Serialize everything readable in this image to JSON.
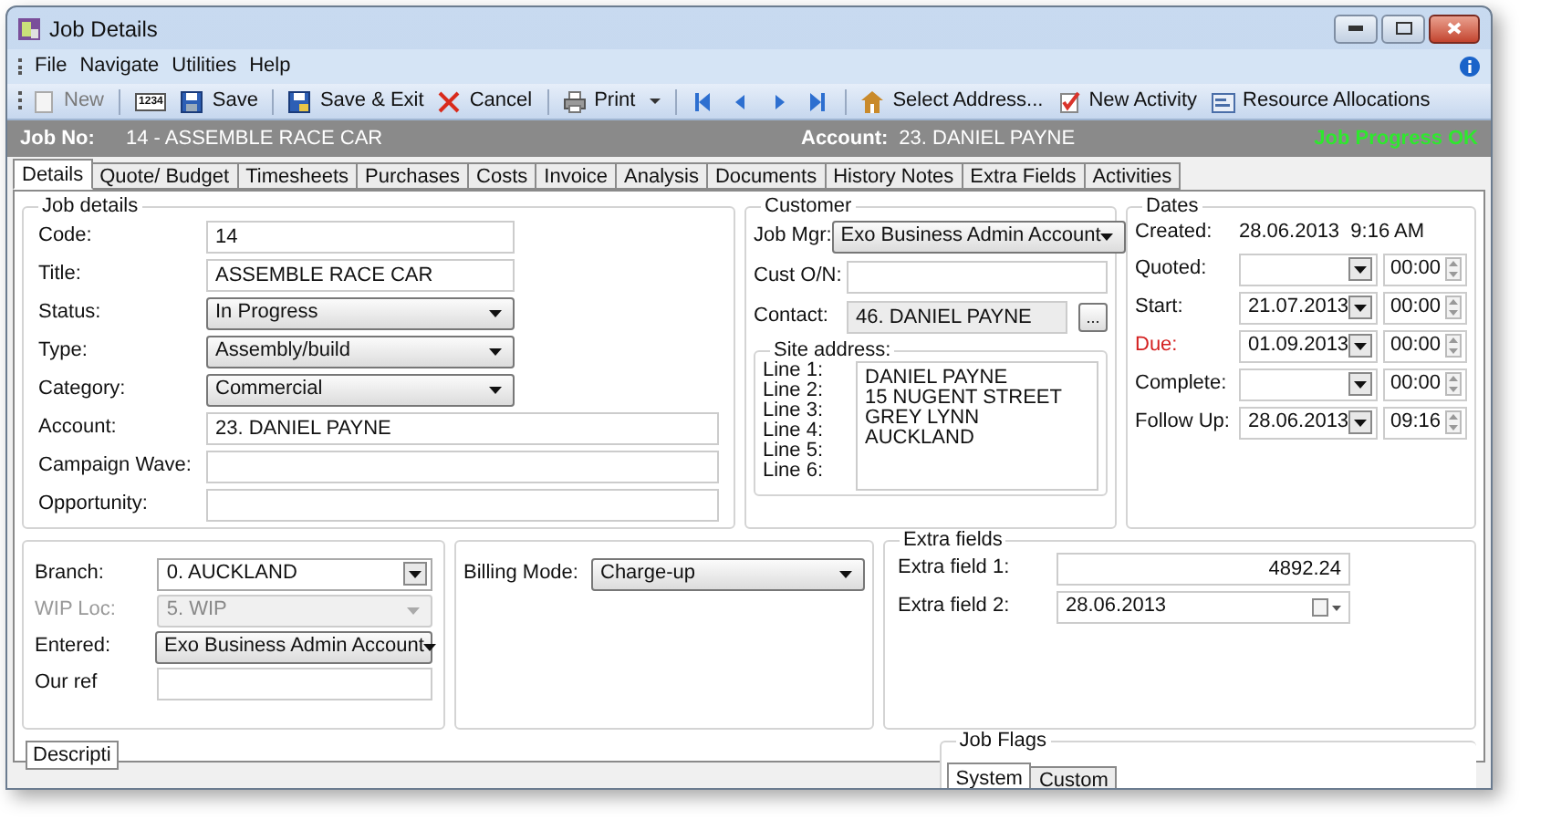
{
  "window": {
    "title": "Job Details"
  },
  "menu": [
    "File",
    "Navigate",
    "Utilities",
    "Help"
  ],
  "toolbar": [
    {
      "kind": "new",
      "label": "New",
      "disabled": true
    },
    {
      "kind": "numbers",
      "label": "1234",
      "disabled": false
    },
    {
      "kind": "save",
      "label": "Save",
      "disabled": false
    },
    {
      "kind": "save-exit",
      "label": "Save & Exit",
      "disabled": false
    },
    {
      "kind": "cancel",
      "label": "Cancel",
      "disabled": false
    },
    {
      "kind": "print",
      "label": "Print",
      "disabled": false
    },
    {
      "kind": "first",
      "disabled": false
    },
    {
      "kind": "prev",
      "disabled": false
    },
    {
      "kind": "next",
      "disabled": false
    },
    {
      "kind": "last",
      "disabled": false
    },
    {
      "kind": "address",
      "label": "Select Address...",
      "disabled": false
    },
    {
      "kind": "activity",
      "label": "New Activity",
      "disabled": false
    },
    {
      "kind": "resource",
      "label": "Resource Allocations",
      "disabled": false
    }
  ],
  "header": {
    "job_label": "Job No:",
    "job_value": "14 - ASSEMBLE RACE CAR",
    "account_label": "Account:",
    "account_value": "23. DANIEL PAYNE",
    "status": "Job Progress OK"
  },
  "tabs": [
    {
      "label": "Details",
      "selected": true
    },
    {
      "label": "Quote/ Budget",
      "selected": false
    },
    {
      "label": "Timesheets",
      "selected": false
    },
    {
      "label": "Purchases",
      "selected": false
    },
    {
      "label": "Costs",
      "selected": false
    },
    {
      "label": "Invoice",
      "selected": false
    },
    {
      "label": "Analysis",
      "selected": false
    },
    {
      "label": "Documents",
      "selected": false
    },
    {
      "label": "History Notes",
      "selected": false
    },
    {
      "label": "Extra Fields",
      "selected": false
    },
    {
      "label": "Activities",
      "selected": false
    }
  ],
  "job_details": {
    "title": "Job details",
    "fields": [
      {
        "label": "Code:",
        "value": "14",
        "kind": "text",
        "wide": false
      },
      {
        "label": "Title:",
        "value": "ASSEMBLE RACE CAR",
        "kind": "text",
        "wide": false
      },
      {
        "label": "Status:",
        "value": "In Progress",
        "kind": "dropdown",
        "wide": false
      },
      {
        "label": "Type:",
        "value": "Assembly/build",
        "kind": "dropdown",
        "wide": false
      },
      {
        "label": "Category:",
        "value": "Commercial",
        "kind": "dropdown",
        "wide": false
      },
      {
        "label": "Account:",
        "value": "23. DANIEL PAYNE",
        "kind": "text",
        "wide": true
      },
      {
        "label": "Campaign Wave:",
        "kind": "text",
        "wide": true
      },
      {
        "label": "Opportunity:",
        "kind": "text",
        "wide": true
      }
    ]
  },
  "customer": {
    "title": "Customer",
    "fields": [
      {
        "label": "Job Mgr:",
        "value": "Exo Business Admin Account",
        "kind": "dropdown"
      },
      {
        "label": "Cust O/N:",
        "kind": "text"
      },
      {
        "label": "Contact:",
        "value": "46. DANIEL PAYNE",
        "kind": "lookup",
        "button": "..."
      }
    ],
    "site_address": {
      "title": "Site address:",
      "labels": [
        "Line 1:",
        "Line 2:",
        "Line 3:",
        "Line 4:",
        "Line 5:",
        "Line 6:"
      ],
      "lines": [
        "DANIEL PAYNE",
        "15 NUGENT STREET",
        "GREY LYNN",
        "AUCKLAND"
      ]
    }
  },
  "dates": {
    "title": "Dates",
    "created_label": "Created:",
    "created_value": "28.06.2013  9:16 AM",
    "rows": [
      {
        "label": "Quoted:",
        "time": "00:00",
        "alert": false
      },
      {
        "label": "Start:",
        "date": "21.07.2013",
        "time": "00:00",
        "alert": false
      },
      {
        "label": "Due:",
        "date": "01.09.2013",
        "time": "00:00",
        "alert": true
      },
      {
        "label": "Complete:",
        "time": "00:00",
        "alert": false
      },
      {
        "label": "Follow Up:",
        "date": "28.06.2013",
        "time": "09:16",
        "alert": false
      }
    ]
  },
  "branch": {
    "fields": [
      {
        "label": "Branch:",
        "value": "0. AUCKLAND",
        "kind": "combo",
        "disabled": false
      },
      {
        "label": "WIP Loc:",
        "value": "5. WIP",
        "kind": "dropdown",
        "disabled": true
      },
      {
        "label": "Entered:",
        "value": "Exo Business Admin Account",
        "kind": "dropdown",
        "disabled": false
      },
      {
        "label": "Our ref",
        "kind": "text",
        "disabled": false
      }
    ]
  },
  "billing": {
    "label": "Billing Mode:",
    "value": "Charge-up"
  },
  "extra_fields": {
    "title": "Extra fields",
    "fields": [
      {
        "label": "Extra field 1:",
        "value": "4892.24",
        "kind": "number"
      },
      {
        "label": "Extra field 2:",
        "value": "28.06.2013",
        "kind": "date"
      }
    ]
  },
  "bottom": {
    "description_tab": "Descripti",
    "job_flags": {
      "title": "Job Flags",
      "tabs": [
        {
          "label": "System",
          "selected": true
        },
        {
          "label": "Custom",
          "selected": false
        }
      ]
    }
  }
}
